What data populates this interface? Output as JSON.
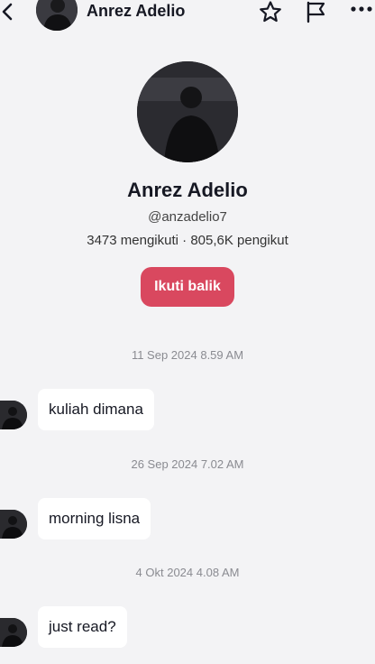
{
  "header": {
    "name": "Anrez Adelio",
    "icons": [
      "back-icon",
      "star-icon",
      "flag-icon",
      "more-icon"
    ]
  },
  "profile": {
    "name": "Anrez Adelio",
    "handle": "@anzadelio7",
    "stats": "3473 mengikuti · 805,6K pengikut",
    "follow_label": "Ikuti balik",
    "follow_color": "#d9485f"
  },
  "messages": [
    {
      "timestamp": "11 Sep 2024 8.59 AM",
      "text": "kuliah dimana"
    },
    {
      "timestamp": "26 Sep 2024 7.02 AM",
      "text": "morning lisna"
    },
    {
      "timestamp": "4 Okt 2024 4.08 AM",
      "text": "just read?"
    }
  ]
}
